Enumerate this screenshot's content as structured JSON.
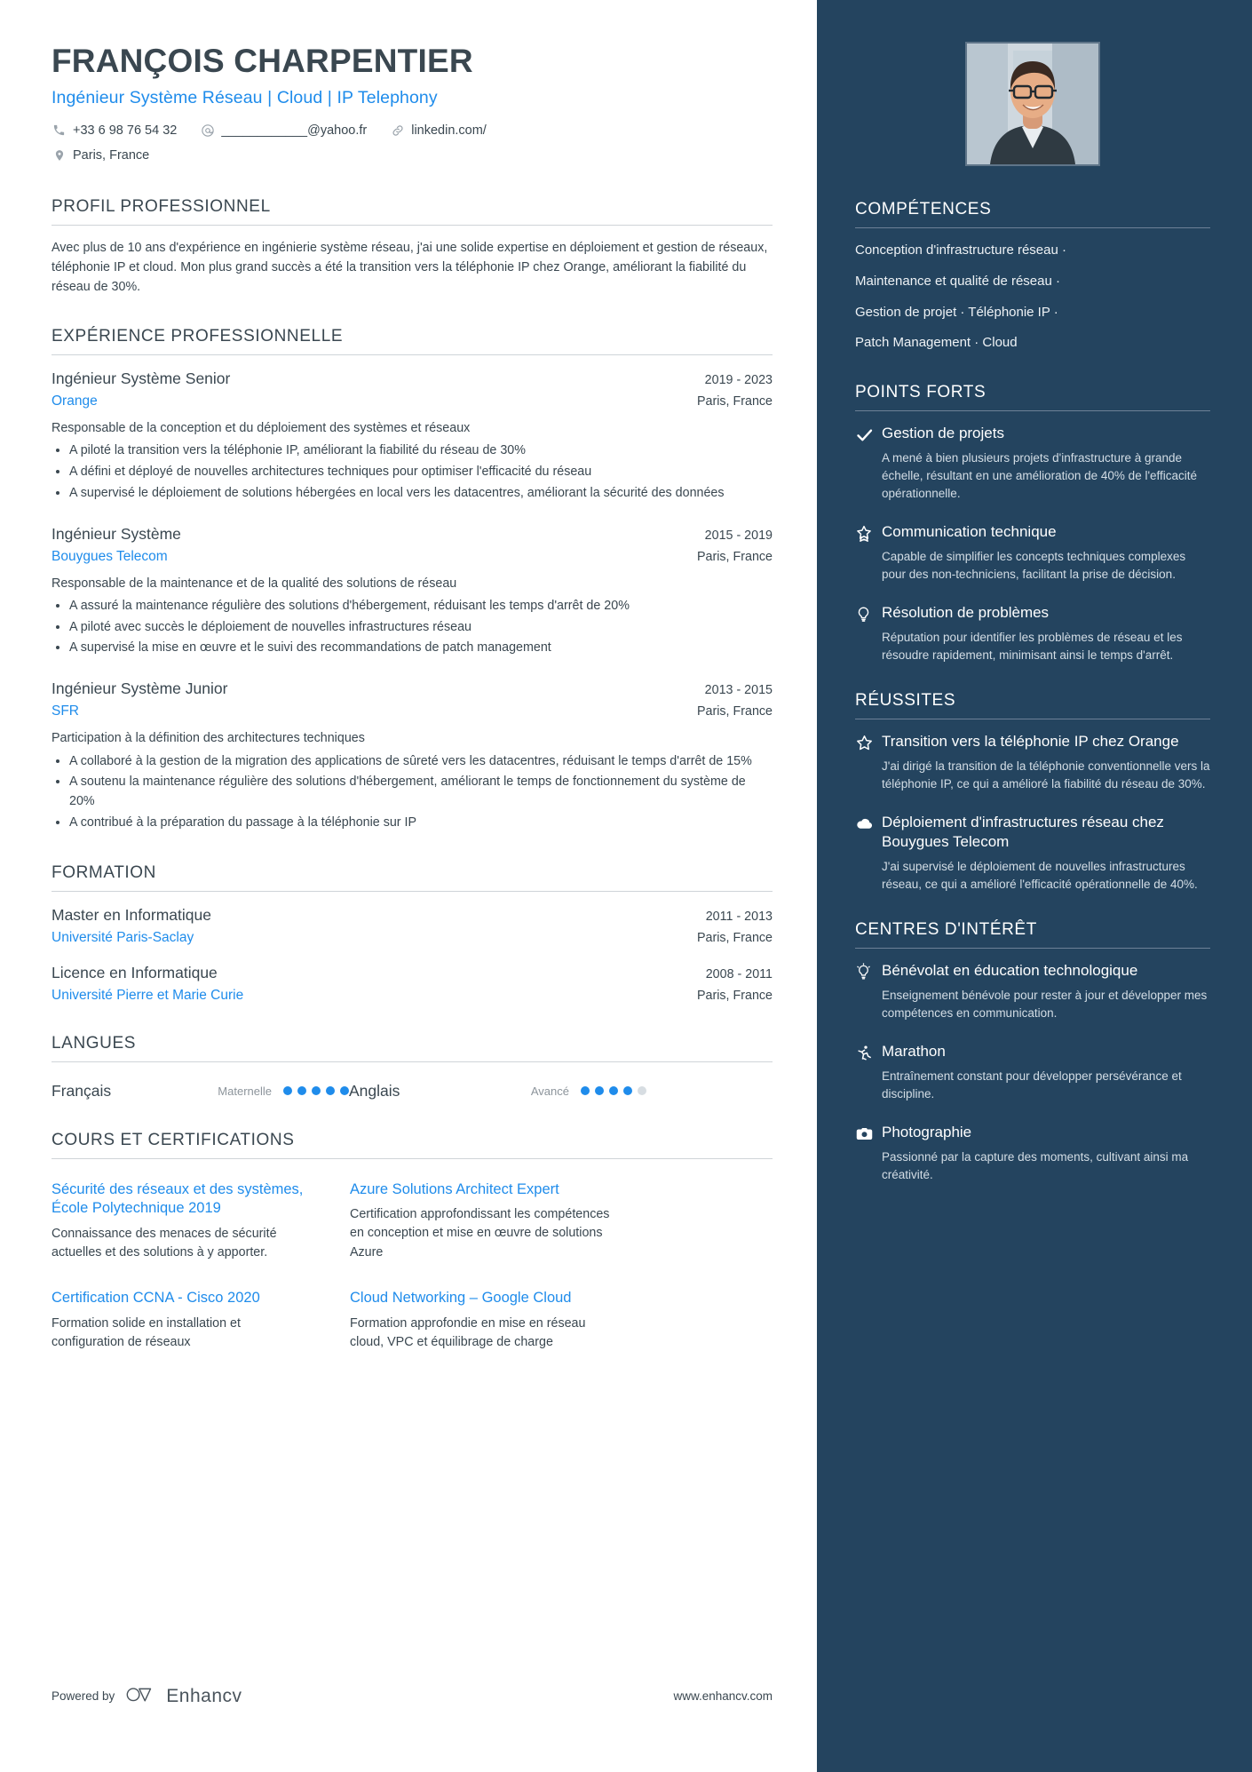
{
  "colors": {
    "accent": "#1f8ceb",
    "sidebar_bg": "#24445f",
    "text": "#3a4750"
  },
  "header": {
    "name": "FRANÇOIS CHARPENTIER",
    "headline": "Ingénieur Système Réseau | Cloud | IP Telephony",
    "contacts": [
      {
        "icon": "phone-icon",
        "text": "+33 6 98 76 54 32"
      },
      {
        "icon": "email-icon",
        "text": "____________@yahoo.fr"
      },
      {
        "icon": "link-icon",
        "text": "linkedin.com/"
      },
      {
        "icon": "location-icon",
        "text": "Paris, France"
      }
    ]
  },
  "profile": {
    "title": "PROFIL PROFESSIONNEL",
    "text": "Avec plus de 10 ans d'expérience en ingénierie système réseau, j'ai une solide expertise en déploiement et gestion de réseaux, téléphonie IP et cloud. Mon plus grand succès a été la transition vers la téléphonie IP chez Orange, améliorant la fiabilité du réseau de 30%."
  },
  "experience": {
    "title": "EXPÉRIENCE PROFESSIONNELLE",
    "items": [
      {
        "role": "Ingénieur Système Senior",
        "dates": "2019 - 2023",
        "company": "Orange",
        "location": "Paris, France",
        "description": "Responsable de la conception et du déploiement des systèmes et réseaux",
        "bullets": [
          "A piloté la transition vers la téléphonie IP, améliorant la fiabilité du réseau de 30%",
          "A défini et déployé de nouvelles architectures techniques pour optimiser l'efficacité du réseau",
          "A supervisé le déploiement de solutions hébergées en local vers les datacentres, améliorant la sécurité des données"
        ]
      },
      {
        "role": "Ingénieur Système",
        "dates": "2015 - 2019",
        "company": "Bouygues Telecom",
        "location": "Paris, France",
        "description": "Responsable de la maintenance et de la qualité des solutions de réseau",
        "bullets": [
          "A assuré la maintenance régulière des solutions d'hébergement, réduisant les temps d'arrêt de 20%",
          "A piloté avec succès le déploiement de nouvelles infrastructures réseau",
          "A supervisé la mise en œuvre et le suivi des recommandations de patch management"
        ]
      },
      {
        "role": "Ingénieur Système Junior",
        "dates": "2013 - 2015",
        "company": "SFR",
        "location": "Paris, France",
        "description": "Participation à la définition des architectures techniques",
        "bullets": [
          "A collaboré à la gestion de la migration des applications de sûreté vers les datacentres, réduisant le temps d'arrêt de 15%",
          "A soutenu la maintenance régulière des solutions d'hébergement, améliorant le temps de fonctionnement du système de 20%",
          "A contribué à la préparation du passage à la téléphonie sur IP"
        ]
      }
    ]
  },
  "education": {
    "title": "FORMATION",
    "items": [
      {
        "degree": "Master en Informatique",
        "dates": "2011 - 2013",
        "school": "Université Paris-Saclay",
        "location": "Paris, France"
      },
      {
        "degree": "Licence en Informatique",
        "dates": "2008 - 2011",
        "school": "Université Pierre et Marie Curie",
        "location": "Paris, France"
      }
    ]
  },
  "languages": {
    "title": "LANGUES",
    "items": [
      {
        "name": "Français",
        "level": "Maternelle",
        "filled": 5,
        "total": 5
      },
      {
        "name": "Anglais",
        "level": "Avancé",
        "filled": 4,
        "total": 5
      }
    ]
  },
  "courses": {
    "title": "COURS ET CERTIFICATIONS",
    "items": [
      {
        "name": "Sécurité des réseaux et des systèmes, École Polytechnique 2019",
        "desc": "Connaissance des menaces de sécurité actuelles et des solutions à y apporter."
      },
      {
        "name": "Azure Solutions Architect Expert",
        "desc": "Certification approfondissant les compétences en conception et mise en œuvre de solutions Azure"
      },
      {
        "name": "Certification CCNA - Cisco 2020",
        "desc": "Formation solide en installation et configuration de réseaux"
      },
      {
        "name": "Cloud Networking – Google Cloud",
        "desc": "Formation approfondie en mise en réseau cloud, VPC et équilibrage de charge"
      }
    ]
  },
  "footer": {
    "powered_by": "Powered by",
    "brand": "Enhancv",
    "website": "www.enhancv.com"
  },
  "sidebar": {
    "skills": {
      "title": "COMPÉTENCES",
      "lines": [
        "Conception d'infrastructure réseau ·",
        "Maintenance et qualité de réseau ·",
        "Gestion de projet · Téléphonie IP ·",
        "Patch Management · Cloud"
      ]
    },
    "strengths": {
      "title": "POINTS FORTS",
      "items": [
        {
          "icon": "check-icon",
          "title": "Gestion de projets",
          "desc": "A mené à bien plusieurs projets d'infrastructure à grande échelle, résultant en une amélioration de 40% de l'efficacité opérationnelle."
        },
        {
          "icon": "star-badge-icon",
          "title": "Communication technique",
          "desc": "Capable de simplifier les concepts techniques complexes pour des non-techniciens, facilitant la prise de décision."
        },
        {
          "icon": "lightbulb-icon",
          "title": "Résolution de problèmes",
          "desc": "Réputation pour identifier les problèmes de réseau et les résoudre rapidement, minimisant ainsi le temps d'arrêt."
        }
      ]
    },
    "achievements": {
      "title": "RÉUSSITES",
      "items": [
        {
          "icon": "star-outline-icon",
          "title": "Transition vers la téléphonie IP chez Orange",
          "desc": "J'ai dirigé la transition de la téléphonie conventionnelle vers la téléphonie IP, ce qui a amélioré la fiabilité du réseau de 30%."
        },
        {
          "icon": "cloud-icon",
          "title": "Déploiement d'infrastructures réseau chez Bouygues Telecom",
          "desc": "J'ai supervisé le déploiement de nouvelles infrastructures réseau, ce qui a amélioré l'efficacité opérationnelle de 40%."
        }
      ]
    },
    "interests": {
      "title": "CENTRES D'INTÉRÊT",
      "items": [
        {
          "icon": "lightbulb-icon",
          "title": "Bénévolat en éducation technologique",
          "desc": "Enseignement bénévole pour rester à jour et développer mes compétences en communication."
        },
        {
          "icon": "runner-icon",
          "title": "Marathon",
          "desc": "Entraînement constant pour développer persévérance et discipline."
        },
        {
          "icon": "camera-icon",
          "title": "Photographie",
          "desc": "Passionné par la capture des moments, cultivant ainsi ma créativité."
        }
      ]
    }
  }
}
